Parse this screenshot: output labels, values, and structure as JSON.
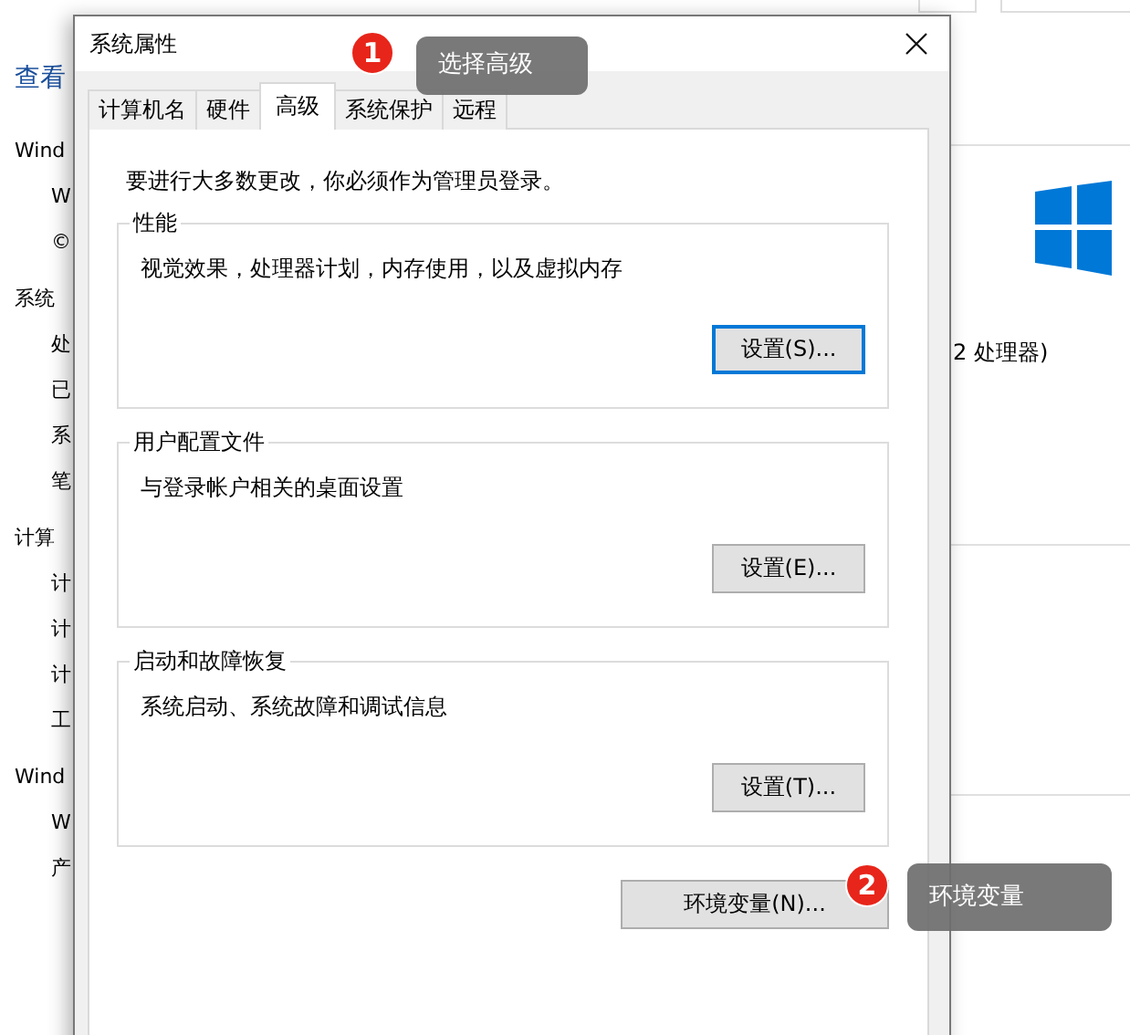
{
  "background_window": {
    "heading": "查看",
    "items": [
      {
        "text": "Wind",
        "kind": "section"
      },
      {
        "text": "W",
        "kind": "item"
      },
      {
        "text": "©",
        "kind": "item"
      },
      {
        "text": "系统",
        "kind": "section"
      },
      {
        "text": "处",
        "kind": "item"
      },
      {
        "text": "已",
        "kind": "item"
      },
      {
        "text": "系",
        "kind": "item"
      },
      {
        "text": "笔",
        "kind": "item"
      },
      {
        "text": "计算",
        "kind": "section"
      },
      {
        "text": "计",
        "kind": "item"
      },
      {
        "text": "计",
        "kind": "item"
      },
      {
        "text": "计",
        "kind": "item"
      },
      {
        "text": "工",
        "kind": "item"
      },
      {
        "text": "Wind",
        "kind": "section"
      },
      {
        "text": "W",
        "kind": "item"
      },
      {
        "text": "产",
        "kind": "item"
      }
    ],
    "processor_text": "2 处理器)"
  },
  "dialog": {
    "title": "系统属性",
    "tabs": [
      {
        "label": "计算机名",
        "selected": false
      },
      {
        "label": "硬件",
        "selected": false
      },
      {
        "label": "高级",
        "selected": true
      },
      {
        "label": "系统保护",
        "selected": false
      },
      {
        "label": "远程",
        "selected": false
      }
    ],
    "notice": "要进行大多数更改，你必须作为管理员登录。",
    "groups": [
      {
        "title": "性能",
        "description": "视觉效果，处理器计划，内存使用，以及虚拟内存",
        "button": {
          "label": "设置(S)...",
          "default": true
        }
      },
      {
        "title": "用户配置文件",
        "description": "与登录帐户相关的桌面设置",
        "button": {
          "label": "设置(E)...",
          "default": false
        }
      },
      {
        "title": "启动和故障恢复",
        "description": "系统启动、系统故障和调试信息",
        "button": {
          "label": "设置(T)...",
          "default": false
        }
      }
    ],
    "env_button": {
      "label": "环境变量(N)...",
      "default": false
    }
  },
  "annotations": [
    {
      "number": "1",
      "text": "选择高级"
    },
    {
      "number": "2",
      "text": "环境变量"
    }
  ]
}
